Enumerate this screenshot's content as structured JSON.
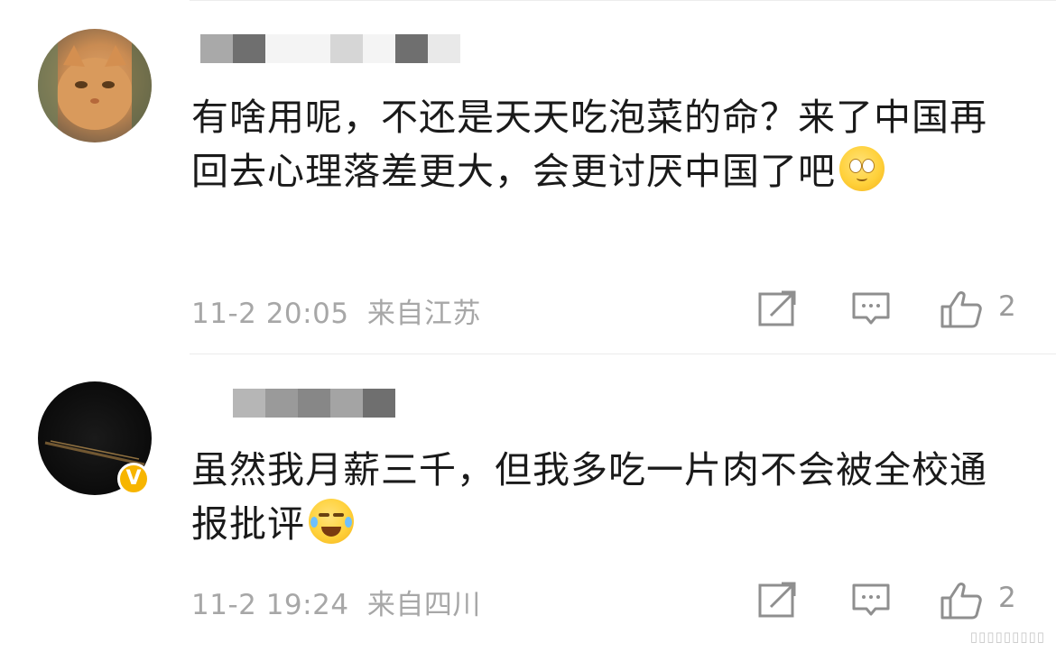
{
  "comments": [
    {
      "avatar": "cat-photo",
      "verified": false,
      "text": "有啥用呢，不还是天天吃泡菜的命？来了中国再回去心理落差更大，会更讨厌中国了吧",
      "emoji": "eye-roll-emoji",
      "time": "11-2 20:05",
      "location": "来自江苏",
      "like_count": "2"
    },
    {
      "avatar": "dark-photo",
      "verified": true,
      "verified_mark": "V",
      "text": "虽然我月薪三千，但我多吃一片肉不会被全校通报批评",
      "emoji": "laugh-cry-emoji",
      "time": "11-2 19:24",
      "location": "来自四川",
      "like_count": "2"
    }
  ],
  "icons": [
    "share-icon",
    "comment-icon",
    "like-icon"
  ],
  "colors": {
    "text": "#1a1a1a",
    "meta": "#a7a7a7",
    "icon": "#8f8f8f",
    "badge": "#f7b500"
  }
}
